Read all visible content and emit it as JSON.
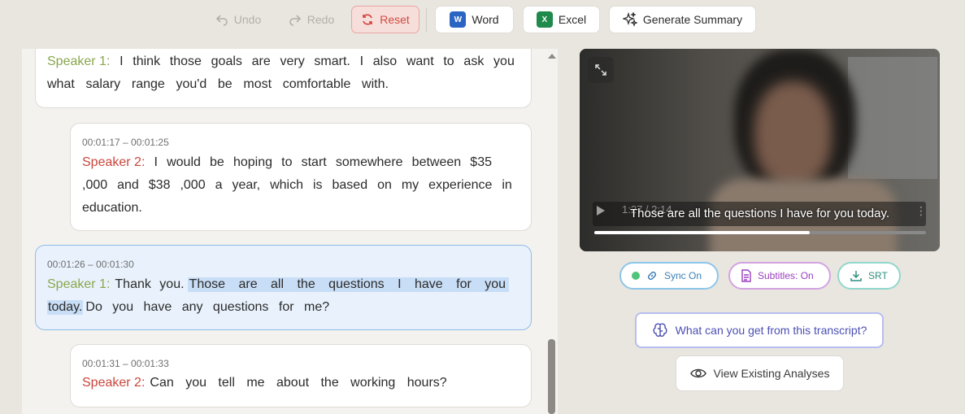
{
  "toolbar": {
    "undo_label": "Undo",
    "redo_label": "Redo",
    "reset_label": "Reset",
    "word_label": "Word",
    "word_icon_letter": "W",
    "excel_label": "Excel",
    "excel_icon_letter": "X",
    "summary_label": "Generate Summary"
  },
  "transcript": {
    "segments": [
      {
        "speaker": "Speaker 1:",
        "lines": [
          [
            "I",
            "think",
            "those",
            "goals",
            "are",
            "very",
            "smart.",
            "I",
            "also",
            "want",
            "to",
            "ask",
            "you"
          ],
          [
            "what",
            "salary",
            "range",
            "you'd",
            "be",
            "most",
            "comfortable",
            "with."
          ]
        ]
      },
      {
        "time": "00:01:17 – 00:01:25",
        "speaker": "Speaker 2:",
        "lines": [
          [
            "I",
            "would",
            "be",
            "hoping",
            "to",
            "start",
            "somewhere",
            "between",
            "$35"
          ],
          [
            ",000",
            "and",
            "$38",
            ",000",
            "a",
            "year,",
            "which",
            "is",
            "based",
            "on",
            "my",
            "experience",
            "in"
          ],
          [
            "education."
          ]
        ]
      },
      {
        "time": "00:01:26 – 00:01:30",
        "speaker": "Speaker 1:",
        "line1_plain": "Thank you.",
        "line1_highlight": "Those are all the questions I have for you",
        "line2_highlight": "today.",
        "line2_plain": "Do you have any questions for me?"
      },
      {
        "time": "00:01:31 – 00:01:33",
        "speaker": "Speaker 2:",
        "text": "Can you tell me about the working hours?"
      }
    ]
  },
  "video": {
    "time_display": "1:27 / 2:14",
    "caption": "Those are all the questions I have for you today.",
    "progress": 0.65
  },
  "pills": {
    "sync": "Sync On",
    "subtitles": "Subtitles: On",
    "srt": "SRT"
  },
  "actions": {
    "analyze": "What can you get from this transcript?",
    "view": "View Existing Analyses"
  },
  "colors": {
    "speaker1": "#8aa64e",
    "speaker2": "#c9463d",
    "highlight": "#c8ddf6",
    "reset": "#d34a42"
  }
}
